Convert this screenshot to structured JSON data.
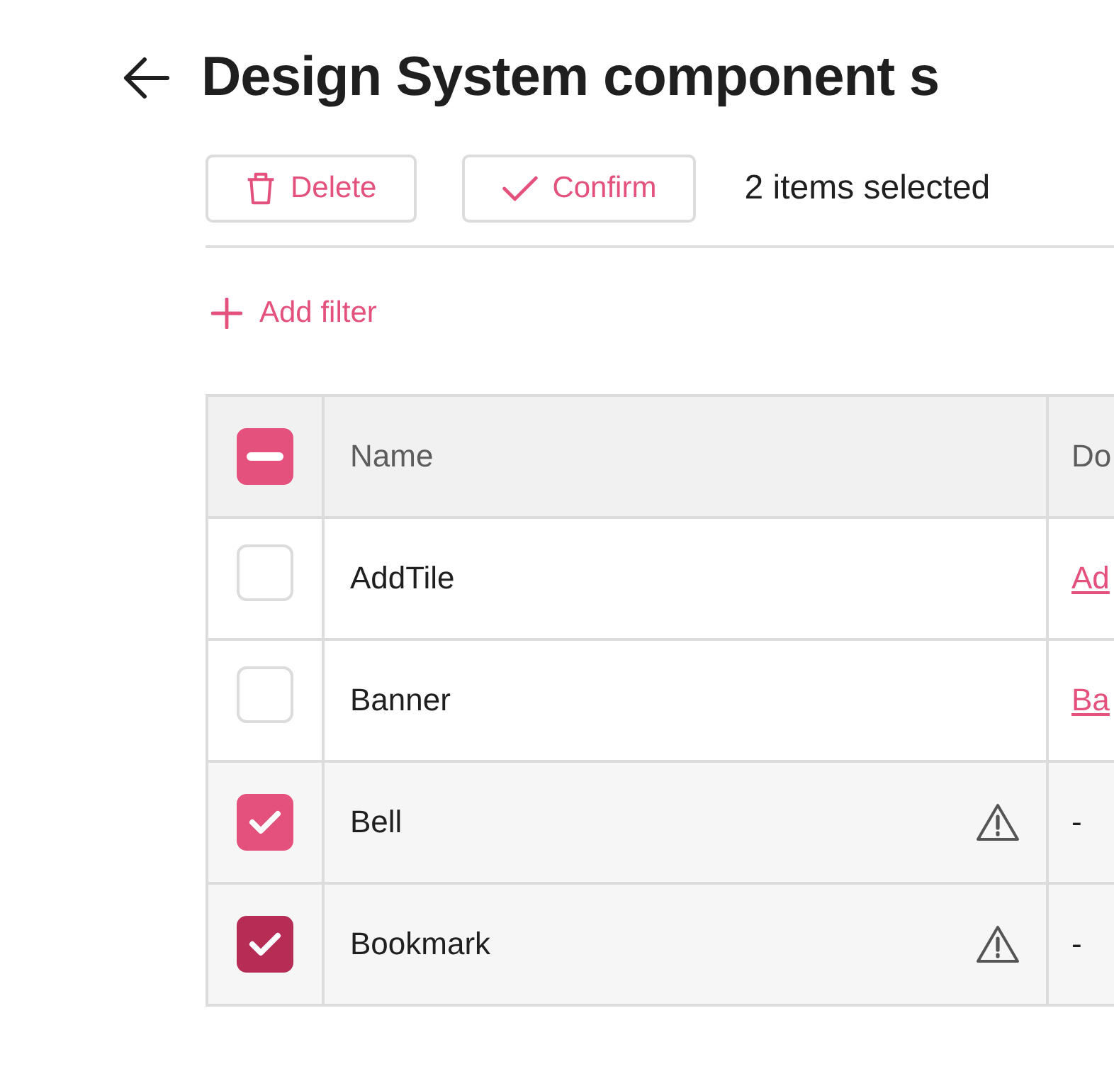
{
  "title": "Design System component s",
  "toolbar": {
    "buttons": [
      {
        "kind": "delete",
        "label": "Delete"
      },
      {
        "kind": "confirm",
        "label": "Confirm"
      }
    ],
    "selection_text": "2 items selected"
  },
  "add_filter": "Add filter",
  "table": {
    "header_checkbox": {
      "indeterminate": true
    },
    "columns": [
      "Name",
      "Do"
    ],
    "rows": [
      {
        "checked": false,
        "hovered": false,
        "name": "AddTile",
        "warning": false,
        "doc": {
          "kind": "link",
          "text": "Ad"
        }
      },
      {
        "checked": false,
        "hovered": false,
        "name": "Banner",
        "warning": false,
        "doc": {
          "kind": "link",
          "text": "Ba"
        }
      },
      {
        "checked": true,
        "hovered": false,
        "name": "Bell",
        "warning": true,
        "doc": {
          "kind": "text",
          "text": "-"
        }
      },
      {
        "checked": true,
        "hovered": true,
        "name": "Bookmark",
        "warning": true,
        "doc": {
          "kind": "text",
          "text": "-"
        }
      }
    ]
  }
}
